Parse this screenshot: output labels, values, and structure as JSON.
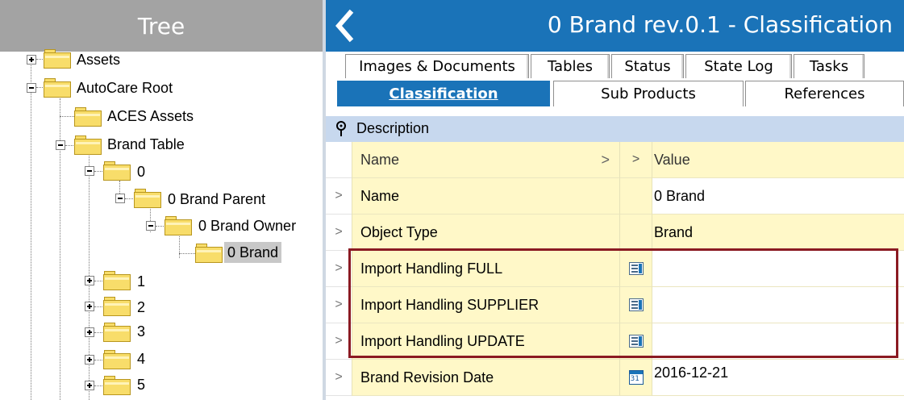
{
  "tree": {
    "title": "Tree",
    "nodes": [
      {
        "label": "Assets",
        "expanded": false
      },
      {
        "label": "AutoCare Root",
        "expanded": true
      },
      {
        "label": "ACES Assets"
      },
      {
        "label": "Brand Table",
        "expanded": true
      },
      {
        "label": "0",
        "expanded": true
      },
      {
        "label": "0 Brand Parent",
        "expanded": true
      },
      {
        "label": "0 Brand Owner",
        "expanded": true
      },
      {
        "label": "0 Brand",
        "selected": true
      },
      {
        "label": "1",
        "expanded": false
      },
      {
        "label": "2",
        "expanded": false
      },
      {
        "label": "3",
        "expanded": false
      },
      {
        "label": "4",
        "expanded": false
      },
      {
        "label": "5",
        "expanded": false
      }
    ]
  },
  "detail": {
    "title": "0 Brand rev.0.1 - Classification",
    "back_icon": "chevron-left-icon",
    "tabs_row1": [
      "Images & Documents",
      "Tables",
      "Status",
      "State Log",
      "Tasks"
    ],
    "tabs_row2": [
      "Classification",
      "Sub Products",
      "References"
    ],
    "active_tab": "Classification"
  },
  "grid": {
    "section": "Description",
    "columns": {
      "name": "Name",
      "name_arrow": ">",
      "icon_arrow": ">",
      "value": "Value"
    },
    "rows": [
      {
        "indicator": ">",
        "name": "Name",
        "icon": "",
        "value": "0 Brand"
      },
      {
        "indicator": ">",
        "name": "Object Type",
        "icon": "",
        "value": "Brand"
      },
      {
        "indicator": ">",
        "name": "Import Handling FULL",
        "icon": "list-icon",
        "value": ""
      },
      {
        "indicator": ">",
        "name": "Import Handling SUPPLIER",
        "icon": "list-icon",
        "value": ""
      },
      {
        "indicator": ">",
        "name": "Import Handling UPDATE",
        "icon": "list-icon",
        "value": ""
      },
      {
        "indicator": ">",
        "name": "Brand Revision Date",
        "icon": "calendar-icon",
        "value": "2016-12-21",
        "calendar_digits": "31"
      }
    ]
  },
  "colors": {
    "tree_header": "#a3a3a3",
    "accent_blue": "#1a73b8",
    "row_yellow": "#fff8c8",
    "section_blue": "#c7d8ee",
    "highlight_red": "#8b1a22",
    "folder_yellow": "#f8dd6a"
  }
}
